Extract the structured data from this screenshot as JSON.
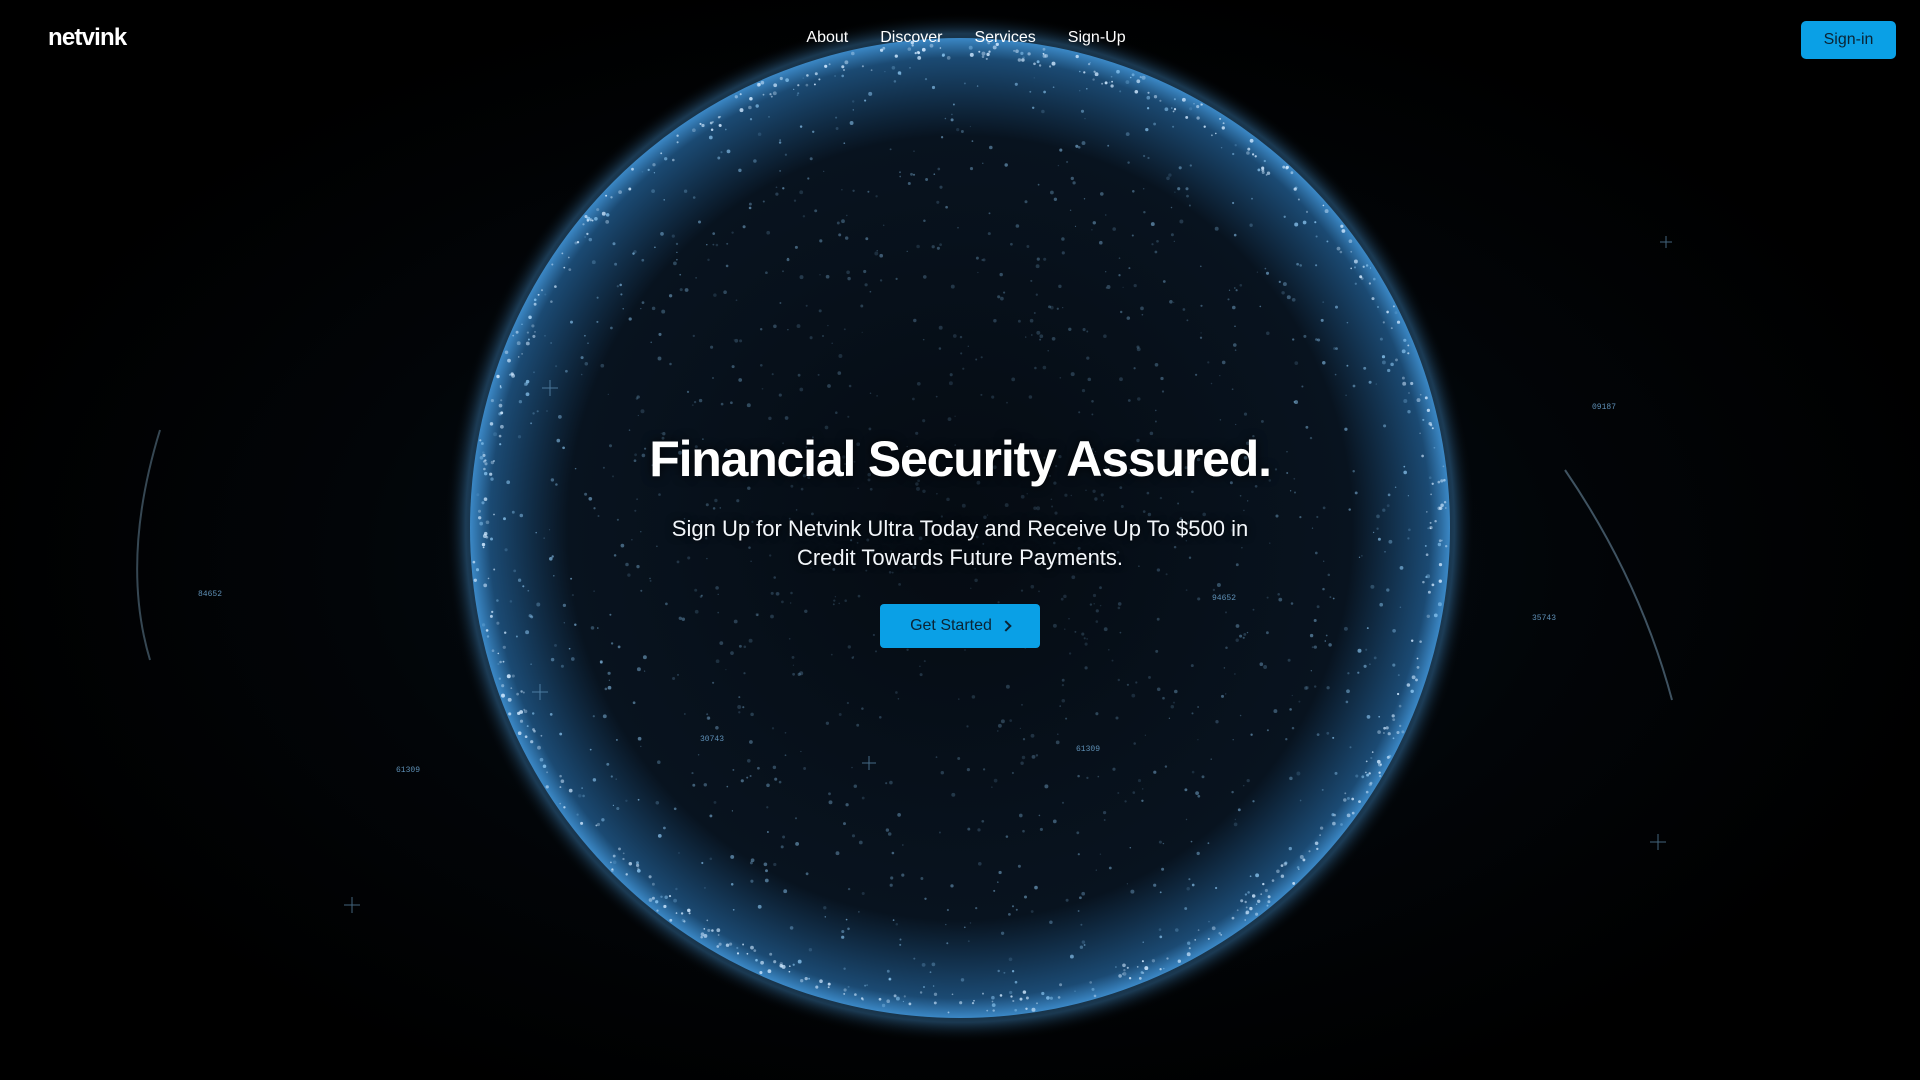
{
  "header": {
    "logo": "netvink",
    "nav": [
      "About",
      "Discover",
      "Services",
      "Sign-Up"
    ],
    "signin_label": "Sign-in"
  },
  "hero": {
    "title": "Financial Security Assured.",
    "subtitle": "Sign Up for Netvink Ultra Today and Receive Up To $500 in Credit Towards Future Payments.",
    "cta_label": "Get Started",
    "cta_icon": "chevron-right-icon"
  },
  "hud_labels": [
    "84652",
    "61309",
    "09187",
    "35743",
    "61309",
    "30743",
    "94652"
  ],
  "colors": {
    "accent": "#0aa0e6",
    "button_text": "#0b2333",
    "globe_glow": "#7cc4ff"
  }
}
